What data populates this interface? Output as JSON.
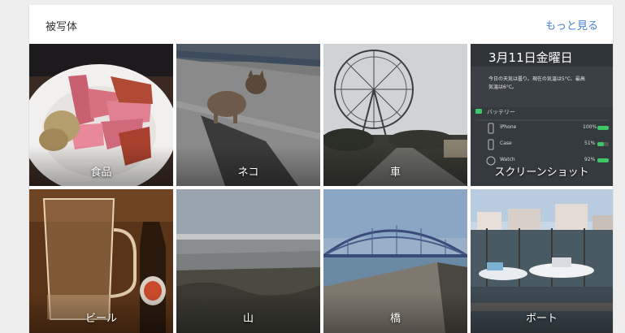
{
  "header": {
    "title": "被写体",
    "more_link": "もっと見る"
  },
  "tiles": [
    {
      "label": "食品"
    },
    {
      "label": "ネコ"
    },
    {
      "label": "車"
    },
    {
      "label": "スクリーンショット"
    },
    {
      "label": "ビール"
    },
    {
      "label": "山"
    },
    {
      "label": "橋"
    },
    {
      "label": "ボート"
    }
  ],
  "screenshot_thumb": {
    "date": "3月11日金曜日",
    "weather_line1": "今日の天気は曇り。現在の気温は5°C、最高",
    "weather_line2": "気温は6°C。",
    "battery_title": "バッテリー",
    "devices": [
      {
        "name": "iPhone",
        "percent": "100%"
      },
      {
        "name": "Case",
        "percent": "51%"
      },
      {
        "name": "Watch",
        "percent": "92%"
      }
    ]
  }
}
